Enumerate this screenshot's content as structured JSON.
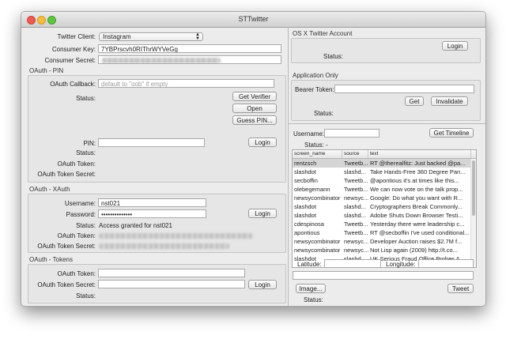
{
  "window": {
    "title": "STTwitter"
  },
  "left": {
    "twitter_client_label": "Twitter Client:",
    "twitter_client_value": "Instagram",
    "consumer_key_label": "Consumer Key:",
    "consumer_key_value": "7YBPrscvh0RIThrWYVeGg",
    "consumer_secret_label": "Consumer Secret:",
    "pin_section": {
      "title": "OAuth - PIN",
      "callback_label": "OAuth Callback:",
      "callback_placeholder": "default to \"oob\" if empty",
      "status_label": "Status:",
      "get_verifier_button": "Get Verifier",
      "open_button": "Open",
      "guess_pin_button": "Guess PIN...",
      "pin_label": "PIN:",
      "login_button": "Login",
      "status2_label": "Status:",
      "token_label": "OAuth Token:",
      "token_secret_label": "OAuth Token Secret:"
    },
    "xauth_section": {
      "title": "OAuth - XAuth",
      "username_label": "Username:",
      "username_value": "nst021",
      "password_label": "Password:",
      "password_value": "••••••••••••••",
      "login_button": "Login",
      "status_label": "Status:",
      "status_value": "Access granted for nst021",
      "token_label": "OAuth Token:",
      "token_secret_label": "OAuth Token Secret:"
    },
    "tokens_section": {
      "title": "OAuth - Tokens",
      "token_label": "OAuth Token:",
      "token_secret_label": "OAuth Token Secret:",
      "login_button": "Login",
      "status_label": "Status:"
    }
  },
  "right": {
    "osx_section": {
      "title": "OS X Twitter Account",
      "login_button": "Login",
      "status_label": "Status:"
    },
    "app_only_section": {
      "title": "Application Only",
      "bearer_label": "Bearer Token:",
      "get_button": "Get",
      "invalidate_button": "Invalidate",
      "status_label": "Status:"
    },
    "timeline": {
      "username_label": "Username:",
      "get_timeline_button": "Get Timeline",
      "status_label": "Status:",
      "status_value": "-",
      "columns": [
        "screen_name",
        "source",
        "text"
      ],
      "rows": [
        [
          "rentzsch",
          "Tweetb...",
          "RT @therealfitz: Just backed @pa..."
        ],
        [
          "slashdot",
          "slashd...",
          "Take Hands-Free 360 Degree Pan..."
        ],
        [
          "secboffin",
          "Tweetb...",
          "@apontious it's at times like this..."
        ],
        [
          "olebegemann",
          "Tweetb...",
          "We can now vote on the talk prop..."
        ],
        [
          "newsycombinator",
          "newsyc...",
          "Google: Do what you want with R..."
        ],
        [
          "slashdot",
          "slashd...",
          "Cryptographers Break Commonly..."
        ],
        [
          "slashdot",
          "slashd...",
          "Adobe Shuts Down Browser Testi..."
        ],
        [
          "cdespinosa",
          "Tweetb...",
          "Yesterday there were leadership c..."
        ],
        [
          "apontious",
          "Tweetb...",
          "RT @secboffin I've used conditional..."
        ],
        [
          "newsycombinator",
          "newsyc...",
          "Developer Auction raises $2.7M f..."
        ],
        [
          "newsycombinator",
          "newsyc...",
          "Not Lisp again (2009) http://t.co..."
        ],
        [
          "slashdot",
          "slashd...",
          "UK Serious Fraud Office Probes A..."
        ]
      ],
      "latitude_label": "Latitude:",
      "longitude_label": "Longitude:",
      "image_button": "Image...",
      "tweet_button": "Tweet",
      "status2_label": "Status:"
    }
  }
}
